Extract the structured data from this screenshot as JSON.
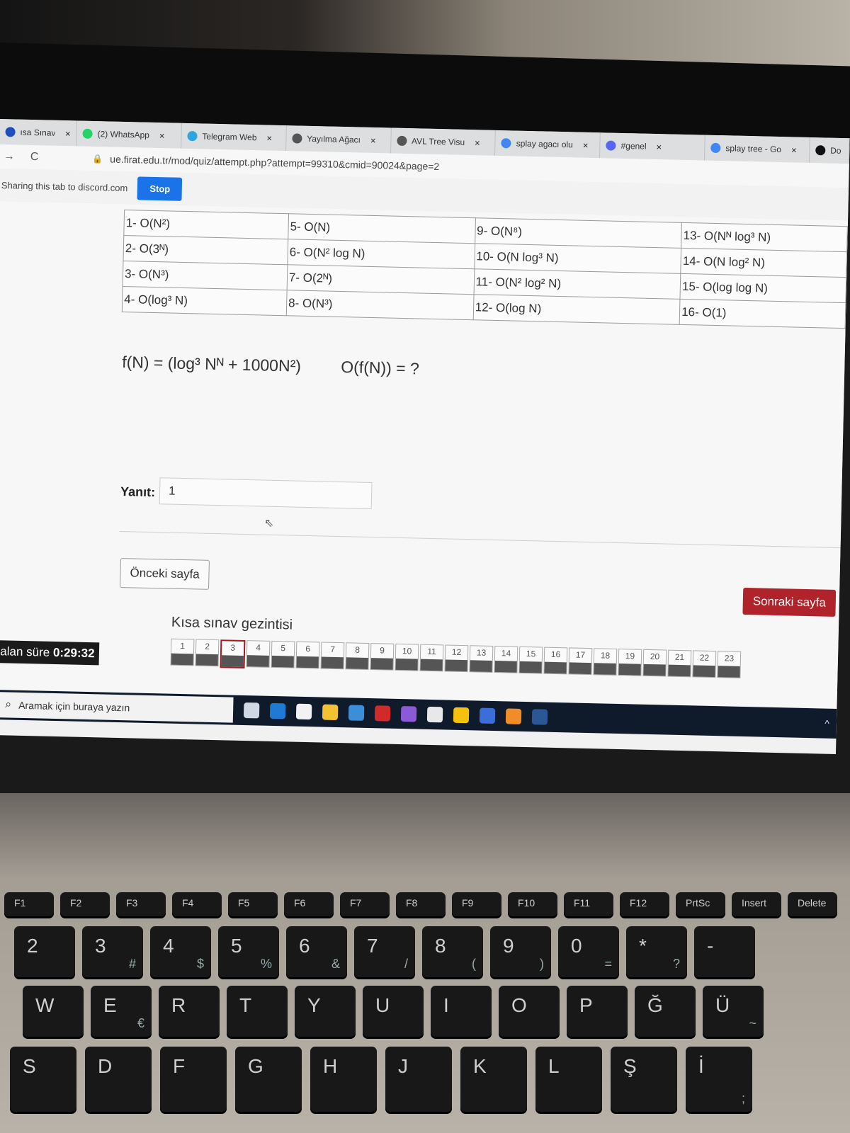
{
  "browser": {
    "tabs": [
      {
        "label": "ısa Sınav",
        "icon": "quiz-icon",
        "color": "#1f4fbf"
      },
      {
        "label": "(2) WhatsApp",
        "icon": "whatsapp-icon",
        "color": "#25d366"
      },
      {
        "label": "Telegram Web",
        "icon": "telegram-icon",
        "color": "#2ca5e0"
      },
      {
        "label": "Yayılma Ağacı",
        "icon": "globe-icon",
        "color": "#555555"
      },
      {
        "label": "AVL Tree Visu",
        "icon": "globe-icon",
        "color": "#555555"
      },
      {
        "label": "splay agacı olu",
        "icon": "google-icon",
        "color": "#4285f4"
      },
      {
        "label": "#genel",
        "icon": "discord-icon",
        "color": "#5865f2"
      },
      {
        "label": "splay tree - Go",
        "icon": "google-icon",
        "color": "#4285f4"
      },
      {
        "label": "Do",
        "icon": "medium-icon",
        "color": "#111111"
      }
    ],
    "close_glyph": "×",
    "url": "ue.firat.edu.tr/mod/quiz/attempt.php?attempt=99310&cmid=90024&page=2",
    "share_text": "Sharing this tab to discord.com",
    "stop_label": "Stop"
  },
  "question": {
    "options_rows": [
      [
        "1- O(N²)",
        "5- O(N)",
        "9- O(N⁸)",
        "13- O(Nᴺ log³ N)"
      ],
      [
        "2- O(3ᴺ)",
        "6- O(N² log N)",
        "10- O(N log³ N)",
        "14- O(N log² N)"
      ],
      [
        "3- O(N³)",
        "7- O(2ᴺ)",
        "11- O(N² log² N)",
        "15- O(log log N)"
      ],
      [
        "4- O(log³ N)",
        "8- O(N³)",
        "12- O(log N)",
        "16- O(1)"
      ]
    ],
    "formula": "f(N) = (log³ Nᴺ + 1000N²)",
    "ask": "O(f(N)) = ?",
    "answer_label": "Yanıt:",
    "answer_value": "1"
  },
  "navigation": {
    "prev_label": "Önceki sayfa",
    "next_label": "Sonraki sayfa",
    "nav_title": "Kısa sınav gezintisi",
    "question_numbers": [
      "1",
      "2",
      "3",
      "4",
      "5",
      "6",
      "7",
      "8",
      "9",
      "10",
      "11",
      "12",
      "13",
      "14",
      "15",
      "16",
      "17",
      "18",
      "19",
      "20",
      "21",
      "22",
      "23"
    ],
    "current_question": "3"
  },
  "timer": {
    "label": "Kalan süre",
    "value": "0:29:32"
  },
  "taskbar": {
    "search_placeholder": "Aramak için buraya yazın",
    "icons": [
      {
        "name": "task-view-icon",
        "color": "#cfd8e3"
      },
      {
        "name": "edge-icon",
        "color": "#1f7ad6"
      },
      {
        "name": "store-icon",
        "color": "#f2f2f2"
      },
      {
        "name": "file-explorer-icon",
        "color": "#f3c233"
      },
      {
        "name": "mail-icon",
        "color": "#3b8fd9"
      },
      {
        "name": "record-icon",
        "color": "#d12a2a"
      },
      {
        "name": "visual-studio-icon",
        "color": "#8c5ad6"
      },
      {
        "name": "unity-icon",
        "color": "#e8e8e8"
      },
      {
        "name": "chrome-icon",
        "color": "#f4c20d"
      },
      {
        "name": "eclipse-icon",
        "color": "#3a6fd8"
      },
      {
        "name": "shield-icon",
        "color": "#f28c28"
      },
      {
        "name": "word-icon",
        "color": "#2b5797"
      }
    ]
  },
  "keyboard": {
    "fn_row": [
      {
        "main": "F1",
        "icon": "mute-icon"
      },
      {
        "main": "F2",
        "icon": "volume-down-icon"
      },
      {
        "main": "F3",
        "icon": "volume-up-icon"
      },
      {
        "main": "F4",
        "icon": "mic-off-icon"
      },
      {
        "main": "F5",
        "icon": "refresh-icon"
      },
      {
        "main": "F6",
        "icon": "touchpad-icon"
      },
      {
        "main": "F7",
        "icon": "airplane-icon"
      },
      {
        "main": "F8",
        "icon": "camera-icon"
      },
      {
        "main": "F9",
        "icon": "lock-icon"
      },
      {
        "main": "F10",
        "icon": "display-icon"
      },
      {
        "main": "F11",
        "icon": "brightness-down-icon"
      },
      {
        "main": "F12",
        "icon": "brightness-up-icon"
      },
      {
        "main": "PrtSc"
      },
      {
        "main": "Insert"
      },
      {
        "main": "Delete"
      }
    ],
    "number_row": [
      {
        "main": "2",
        "sub": ""
      },
      {
        "main": "3",
        "sub": "#"
      },
      {
        "main": "4",
        "sub": "$"
      },
      {
        "main": "5",
        "sub": "%"
      },
      {
        "main": "6",
        "sub": "&"
      },
      {
        "main": "7",
        "sub": "/"
      },
      {
        "main": "8",
        "sub": "("
      },
      {
        "main": "9",
        "sub": ")"
      },
      {
        "main": "0",
        "sub": "="
      },
      {
        "main": "*",
        "sub": "?"
      },
      {
        "main": "-",
        "sub": ""
      }
    ],
    "q_row": [
      {
        "main": "W",
        "sub": ""
      },
      {
        "main": "E",
        "sub": "€"
      },
      {
        "main": "R",
        "sub": ""
      },
      {
        "main": "T",
        "sub": ""
      },
      {
        "main": "Y",
        "sub": ""
      },
      {
        "main": "U",
        "sub": ""
      },
      {
        "main": "I",
        "sub": ""
      },
      {
        "main": "O",
        "sub": ""
      },
      {
        "main": "P",
        "sub": ""
      },
      {
        "main": "Ğ",
        "sub": ""
      },
      {
        "main": "Ü",
        "sub": "~"
      }
    ],
    "a_row": [
      {
        "main": "S",
        "sub": ""
      },
      {
        "main": "D",
        "sub": ""
      },
      {
        "main": "F",
        "sub": ""
      },
      {
        "main": "G",
        "sub": ""
      },
      {
        "main": "H",
        "sub": ""
      },
      {
        "main": "J",
        "sub": ""
      },
      {
        "main": "K",
        "sub": ""
      },
      {
        "main": "L",
        "sub": ""
      },
      {
        "main": "Ş",
        "sub": ""
      },
      {
        "main": "İ",
        "sub": ";"
      }
    ]
  }
}
